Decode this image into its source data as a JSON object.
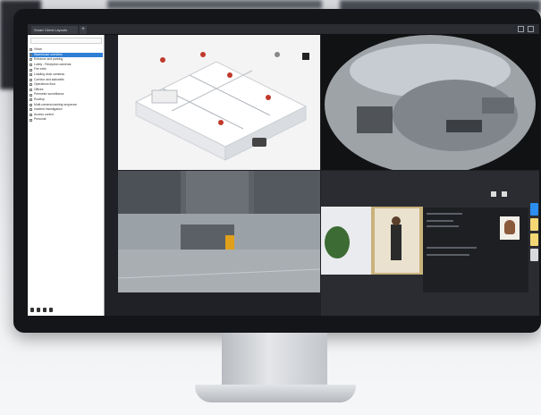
{
  "app": {
    "tab_label": "Smart Client Layouts",
    "tab_add": "+"
  },
  "sidebar": {
    "search_placeholder": "",
    "items": [
      {
        "label": "Views"
      },
      {
        "label": "Warehouse overview",
        "selected": true
      },
      {
        "label": "Entrance and parking"
      },
      {
        "label": "Lobby - Reception cameras"
      },
      {
        "label": "Fire exits"
      },
      {
        "label": "Loading dock cameras"
      },
      {
        "label": "Corridor and stairwells"
      },
      {
        "label": "Operations floor"
      },
      {
        "label": "Offices"
      },
      {
        "label": "Perimeter surveillance"
      },
      {
        "label": "Rooftop"
      },
      {
        "label": "Multi-camera tracking sequence"
      },
      {
        "label": "Incident investigation"
      },
      {
        "label": "Access control"
      },
      {
        "label": "Personal"
      }
    ]
  },
  "colors": {
    "accent": "#2f7fd6",
    "rail_blue": "#2b8ef0",
    "rail_yellow": "#f3d774",
    "rail_gray": "#d7d9dc"
  },
  "icons": {
    "rail": [
      "map-pin-icon",
      "alarm-icon",
      "light-icon",
      "more-icon"
    ],
    "footer": [
      "add-icon",
      "edit-icon",
      "delete-icon",
      "settings-icon"
    ]
  }
}
